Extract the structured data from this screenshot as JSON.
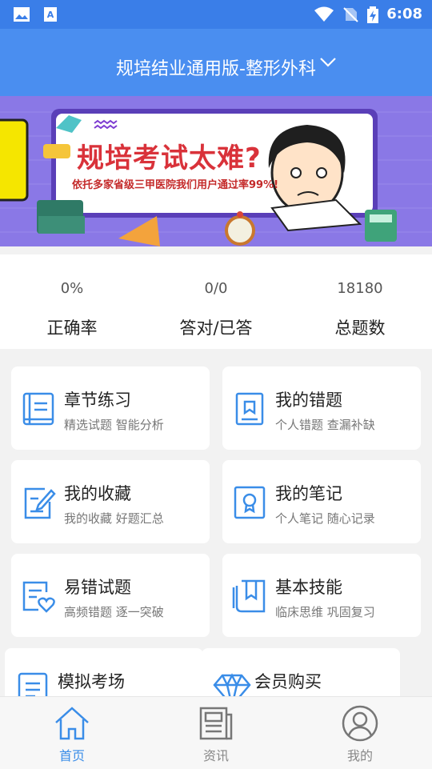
{
  "status_bar": {
    "time": "6:08"
  },
  "header": {
    "title": "规培结业通用版-整形外科"
  },
  "banner": {
    "headline": "规培考试太难?",
    "subline": "依托多家省级三甲医院我们用户通过率99%!"
  },
  "stats": [
    {
      "value": "0%",
      "label": "正确率"
    },
    {
      "value": "0/0",
      "label": "答对/已答"
    },
    {
      "value": "18180",
      "label": "总题数"
    }
  ],
  "cards": [
    {
      "title": "章节练习",
      "subtitle": "精选试题 智能分析",
      "icon": "book-icon"
    },
    {
      "title": "我的错题",
      "subtitle": "个人错题 查漏补缺",
      "icon": "error-book-icon"
    },
    {
      "title": "我的收藏",
      "subtitle": "我的收藏 好题汇总",
      "icon": "edit-note-icon"
    },
    {
      "title": "我的笔记",
      "subtitle": "个人笔记 随心记录",
      "icon": "notebook-icon"
    },
    {
      "title": "易错试题",
      "subtitle": "高频错题 逐一突破",
      "icon": "heart-list-icon"
    },
    {
      "title": "基本技能",
      "subtitle": "临床思维 巩固复习",
      "icon": "bookmark-book-icon"
    },
    {
      "title": "模拟考场",
      "subtitle": "",
      "icon": "exam-doc-icon"
    },
    {
      "title": "会员购买",
      "subtitle": "",
      "icon": "diamond-icon"
    }
  ],
  "tabs": [
    {
      "label": "首页",
      "icon": "home-icon",
      "active": true
    },
    {
      "label": "资讯",
      "icon": "news-icon",
      "active": false
    },
    {
      "label": "我的",
      "icon": "profile-icon",
      "active": false
    }
  ],
  "colors": {
    "accent": "#3a8de8",
    "header": "#4a8ef0",
    "statusbar": "#3a7ee8"
  }
}
